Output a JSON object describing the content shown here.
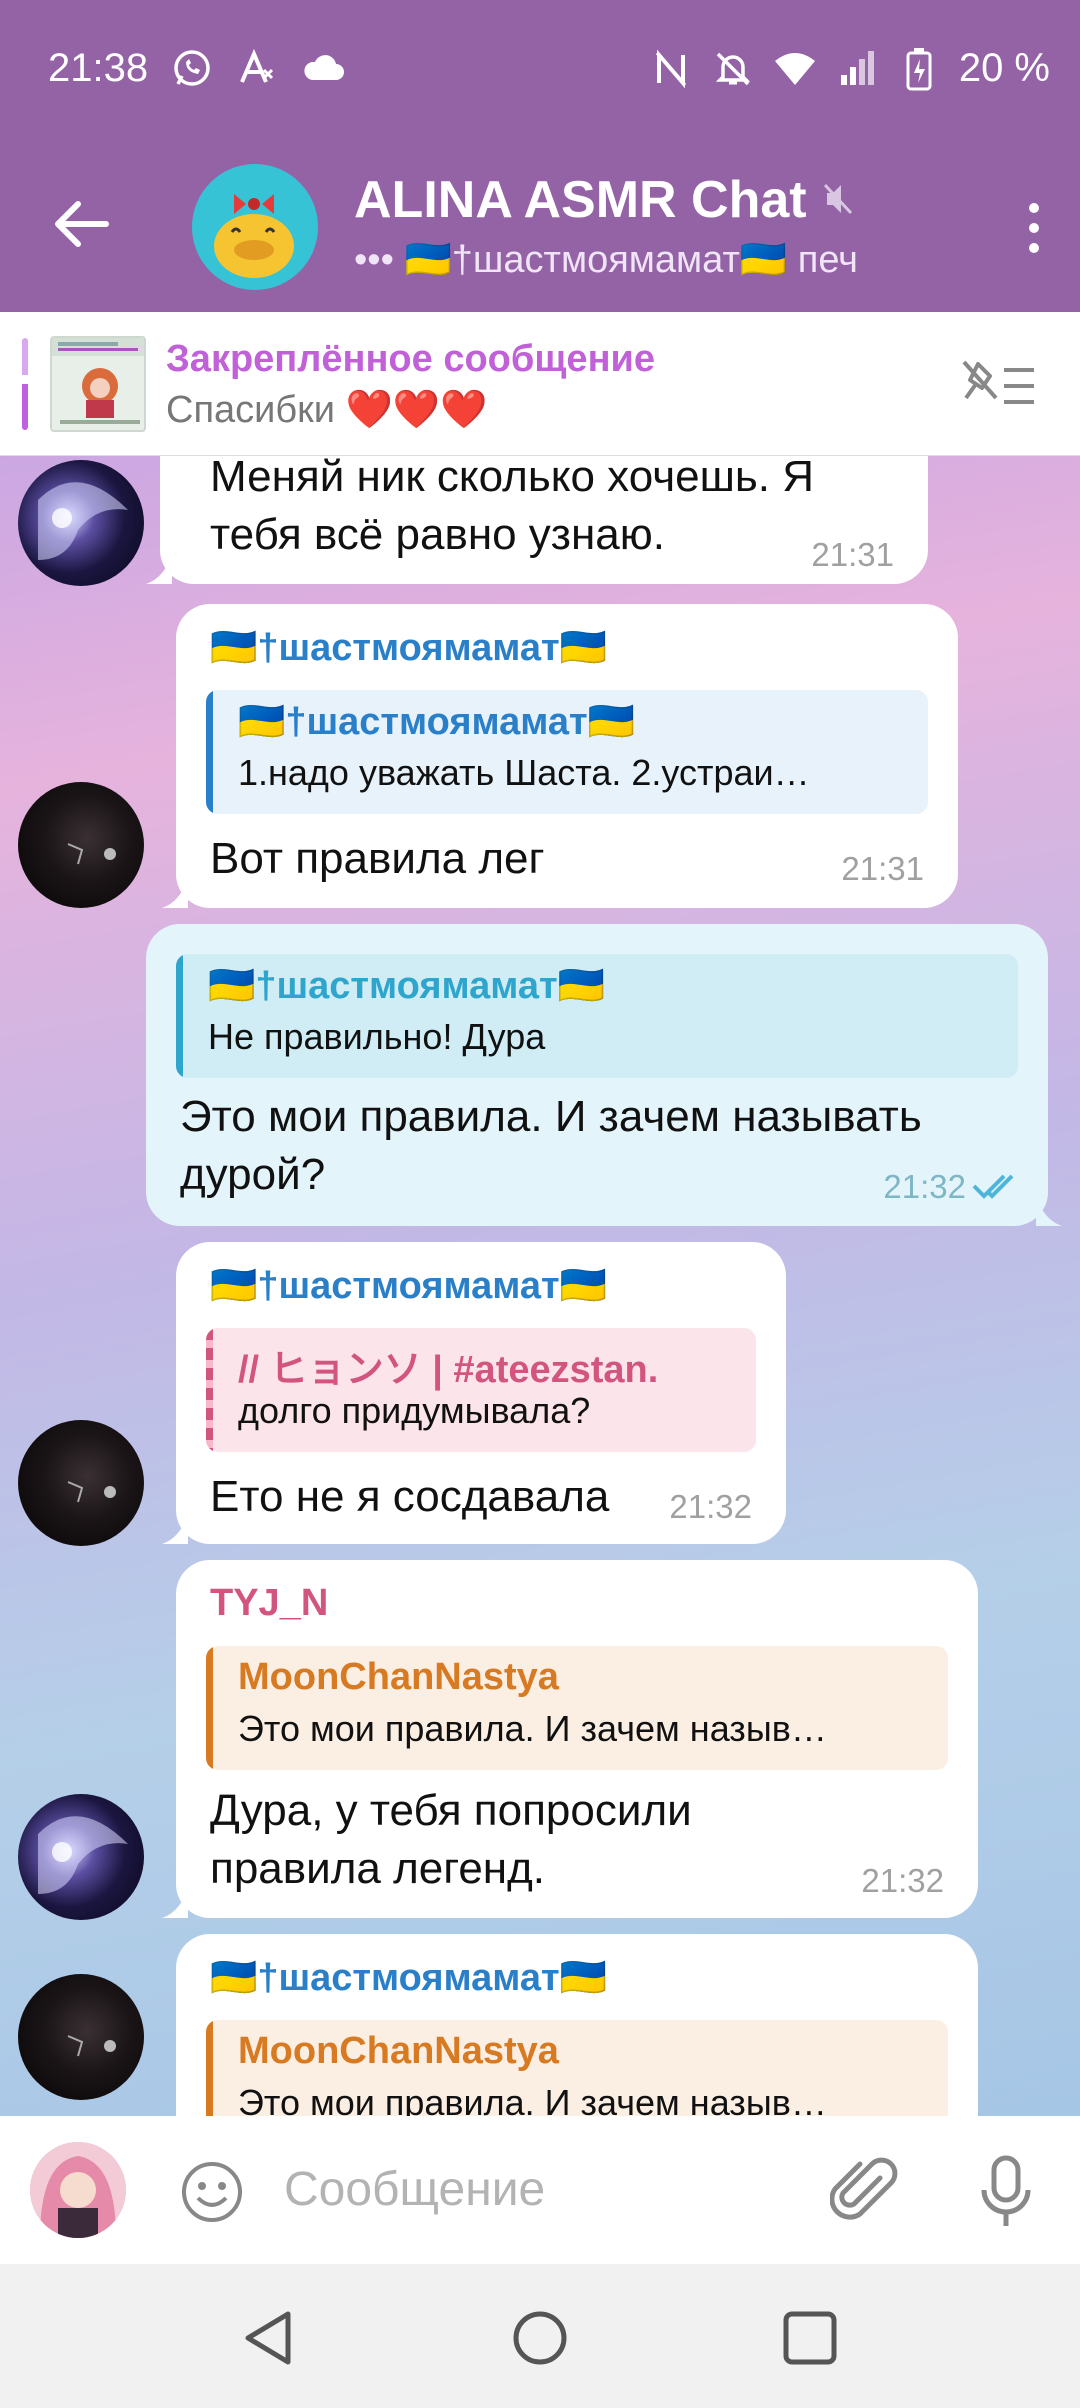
{
  "status_bar": {
    "time": "21:38",
    "battery": "20 %",
    "icons_left": [
      "whatsapp-icon",
      "translate-icon",
      "cloud-icon"
    ],
    "icons_right": [
      "nfc-icon",
      "mute-icon",
      "wifi-icon",
      "signal-icon",
      "battery-icon"
    ]
  },
  "header": {
    "title": "ALINA ASMR Chat",
    "subtitle": "••• 🇺🇦†шастмоямамат🇺🇦 печ",
    "muted_icon": "muted-icon",
    "accent_color": "#9463a6"
  },
  "pinned": {
    "title": "Закреплённое сообщение",
    "text": "Спасибки ❤️❤️❤️"
  },
  "messages": [
    {
      "type": "in",
      "text": "Меняй ник сколько хочешь. Я\nтебя всё равно узнаю.",
      "time": "21:31"
    },
    {
      "type": "in",
      "sender": "🇺🇦†шастмоямамат🇺🇦",
      "reply_name": "🇺🇦†шастмоямамат🇺🇦",
      "reply_text": "1.надо уважать Шаста. 2.устраи…",
      "text": "Вот правила лег",
      "time": "21:31"
    },
    {
      "type": "out",
      "reply_name": "🇺🇦†шастмоямамат🇺🇦",
      "reply_text": "Не правильно! Дура",
      "text": "Это мои правила. И зачем называть\nдурой?",
      "time": "21:32"
    },
    {
      "type": "in",
      "sender": "🇺🇦†шастмоямамат🇺🇦",
      "reply_name": "// ヒョンソ | #ateezstan.",
      "reply_text": "долго придумывала?",
      "text": "Ето не я сосдавала",
      "time": "21:32"
    },
    {
      "type": "in",
      "sender": "TYJ_N",
      "reply_name": "MoonChanNastya",
      "reply_text": "Это мои правила. И зачем назыв…",
      "text": "Дура, у тебя попросили\nправила легенд.",
      "time": "21:32"
    },
    {
      "type": "in",
      "sender": "🇺🇦†шастмоямамат🇺🇦",
      "reply_name": "MoonChanNastya",
      "reply_text": "Это мои правила. И зачем назыв…"
    }
  ],
  "input": {
    "placeholder": "Сообщение"
  },
  "colors": {
    "name_blue": "#2a7fc9",
    "name_pink": "#d2557f",
    "name_orange": "#d77a22",
    "read_check": "#4fb5d8"
  }
}
